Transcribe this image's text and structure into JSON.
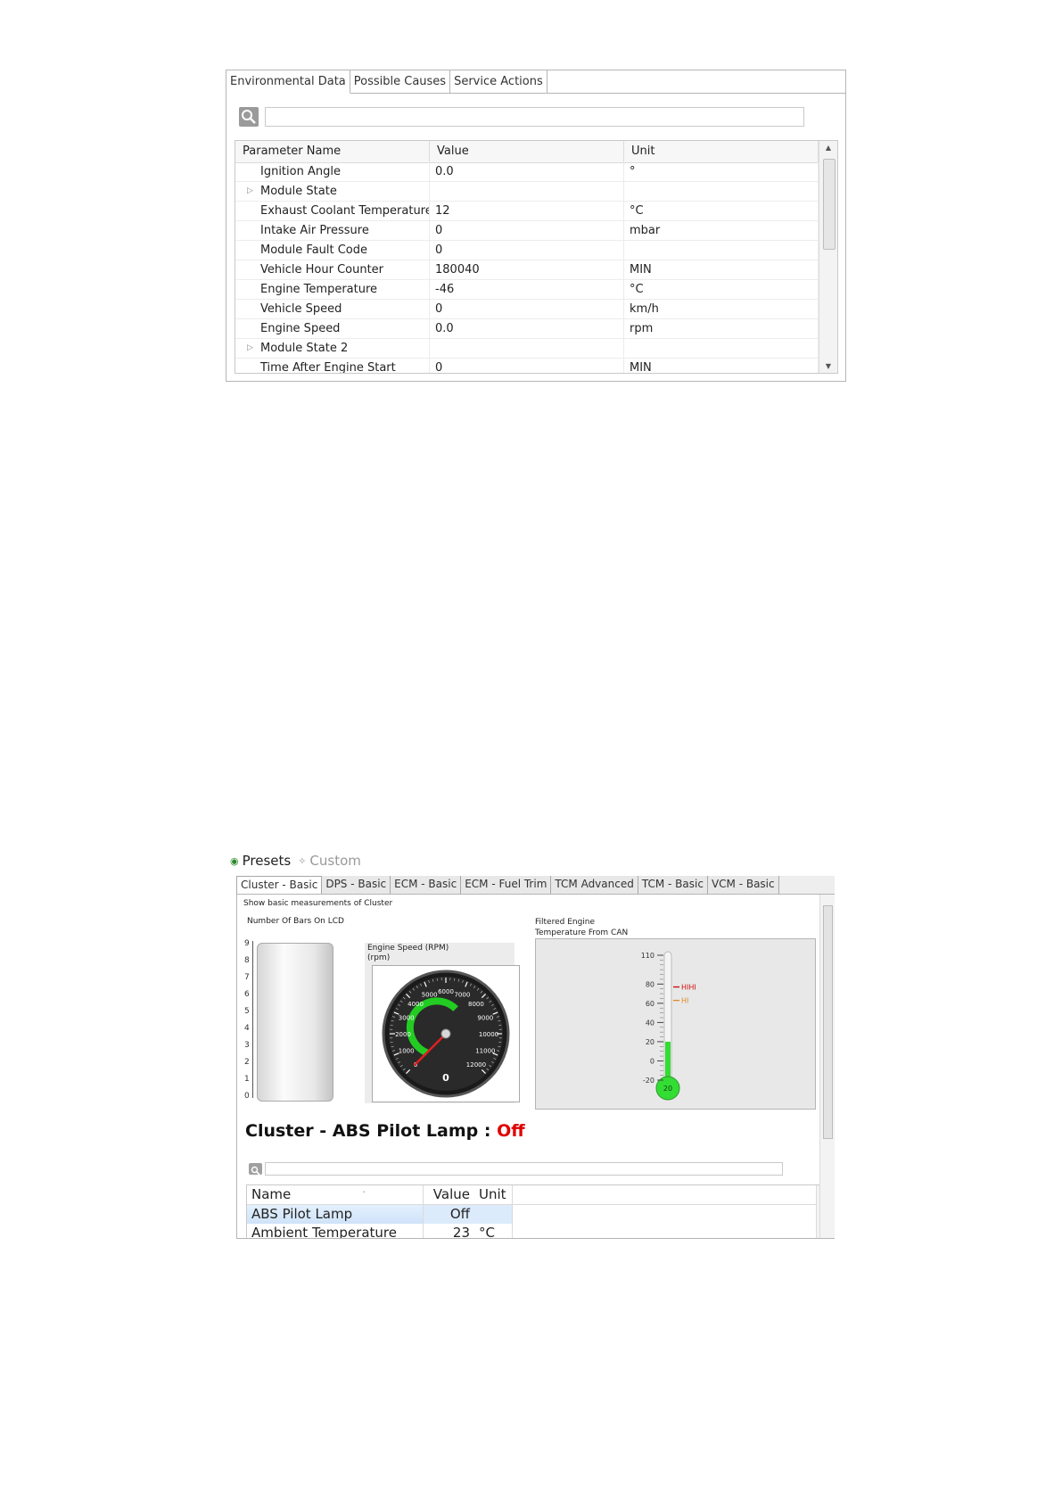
{
  "panel1": {
    "tabs": [
      "Environmental Data",
      "Possible Causes",
      "Service Actions"
    ],
    "search": {
      "value": ""
    },
    "columns": [
      "Parameter Name",
      "Value",
      "Unit"
    ],
    "rows": [
      {
        "name": "Ignition Angle",
        "value": "0.0",
        "unit": "°",
        "expandable": false
      },
      {
        "name": "Module State",
        "value": "",
        "unit": "",
        "expandable": true
      },
      {
        "name": "Exhaust Coolant Temperature",
        "value": "12",
        "unit": "°C",
        "expandable": false
      },
      {
        "name": "Intake Air Pressure",
        "value": "0",
        "unit": "mbar",
        "expandable": false
      },
      {
        "name": "Module Fault Code",
        "value": "0",
        "unit": "",
        "expandable": false
      },
      {
        "name": "Vehicle Hour Counter",
        "value": "180040",
        "unit": "MIN",
        "expandable": false
      },
      {
        "name": "Engine Temperature",
        "value": "-46",
        "unit": "°C",
        "expandable": false
      },
      {
        "name": "Vehicle Speed",
        "value": "0",
        "unit": "km/h",
        "expandable": false
      },
      {
        "name": "Engine Speed",
        "value": "0.0",
        "unit": "rpm",
        "expandable": false
      },
      {
        "name": "Module State 2",
        "value": "",
        "unit": "",
        "expandable": true
      },
      {
        "name": "Time After Engine Start",
        "value": "0",
        "unit": "MIN",
        "expandable": false
      }
    ]
  },
  "panel2": {
    "modes": {
      "presets": "Presets",
      "custom": "Custom"
    },
    "tabs": [
      "Cluster - Basic",
      "DPS - Basic",
      "ECM - Basic",
      "ECM - Fuel Trim",
      "TCM Advanced",
      "TCM - Basic",
      "VCM - Basic"
    ],
    "active_tab": 0,
    "description": "Show basic measurements of Cluster",
    "bars": {
      "title": "Number Of Bars On LCD",
      "ticks": [
        "9",
        "8",
        "7",
        "6",
        "5",
        "4",
        "3",
        "2",
        "1",
        "0"
      ],
      "value": 0
    },
    "gauge": {
      "title_line1": "Engine Speed (RPM)",
      "title_line2": "(rpm)",
      "ticks": [
        "0",
        "1000",
        "2000",
        "3000",
        "4000",
        "5000",
        "6000",
        "7000",
        "8000",
        "9000",
        "10000",
        "11000",
        "12000"
      ],
      "readout": "0",
      "value": 0,
      "min": 0,
      "max": 12000
    },
    "thermometer": {
      "title_line1": "Filtered Engine",
      "title_line2": "Temperature From CAN",
      "ticks": [
        "110",
        "80",
        "60",
        "40",
        "20",
        "0",
        "-20"
      ],
      "value": 20,
      "bulb_label": "20",
      "min": -20,
      "max": 110,
      "markers": [
        {
          "label": "HIHI",
          "value": 77,
          "color": "#d01010"
        },
        {
          "label": "HI",
          "value": 63,
          "color": "#e08a2c"
        }
      ]
    },
    "lamp": {
      "label": "Cluster - ABS Pilot Lamp : ",
      "value": "Off"
    },
    "search": {
      "value": ""
    },
    "table": {
      "columns": [
        "Name",
        "Value",
        "Unit"
      ],
      "rows": [
        {
          "name": "ABS Pilot Lamp",
          "value": "Off",
          "unit": ""
        },
        {
          "name": "Ambient Temperature",
          "value": "23",
          "unit": "°C"
        }
      ]
    }
  },
  "colors": {
    "gauge_arc": "#22cc22",
    "needle": "#e02020",
    "thermo_fill": "#33dd33",
    "lamp_off": "#e00000"
  }
}
